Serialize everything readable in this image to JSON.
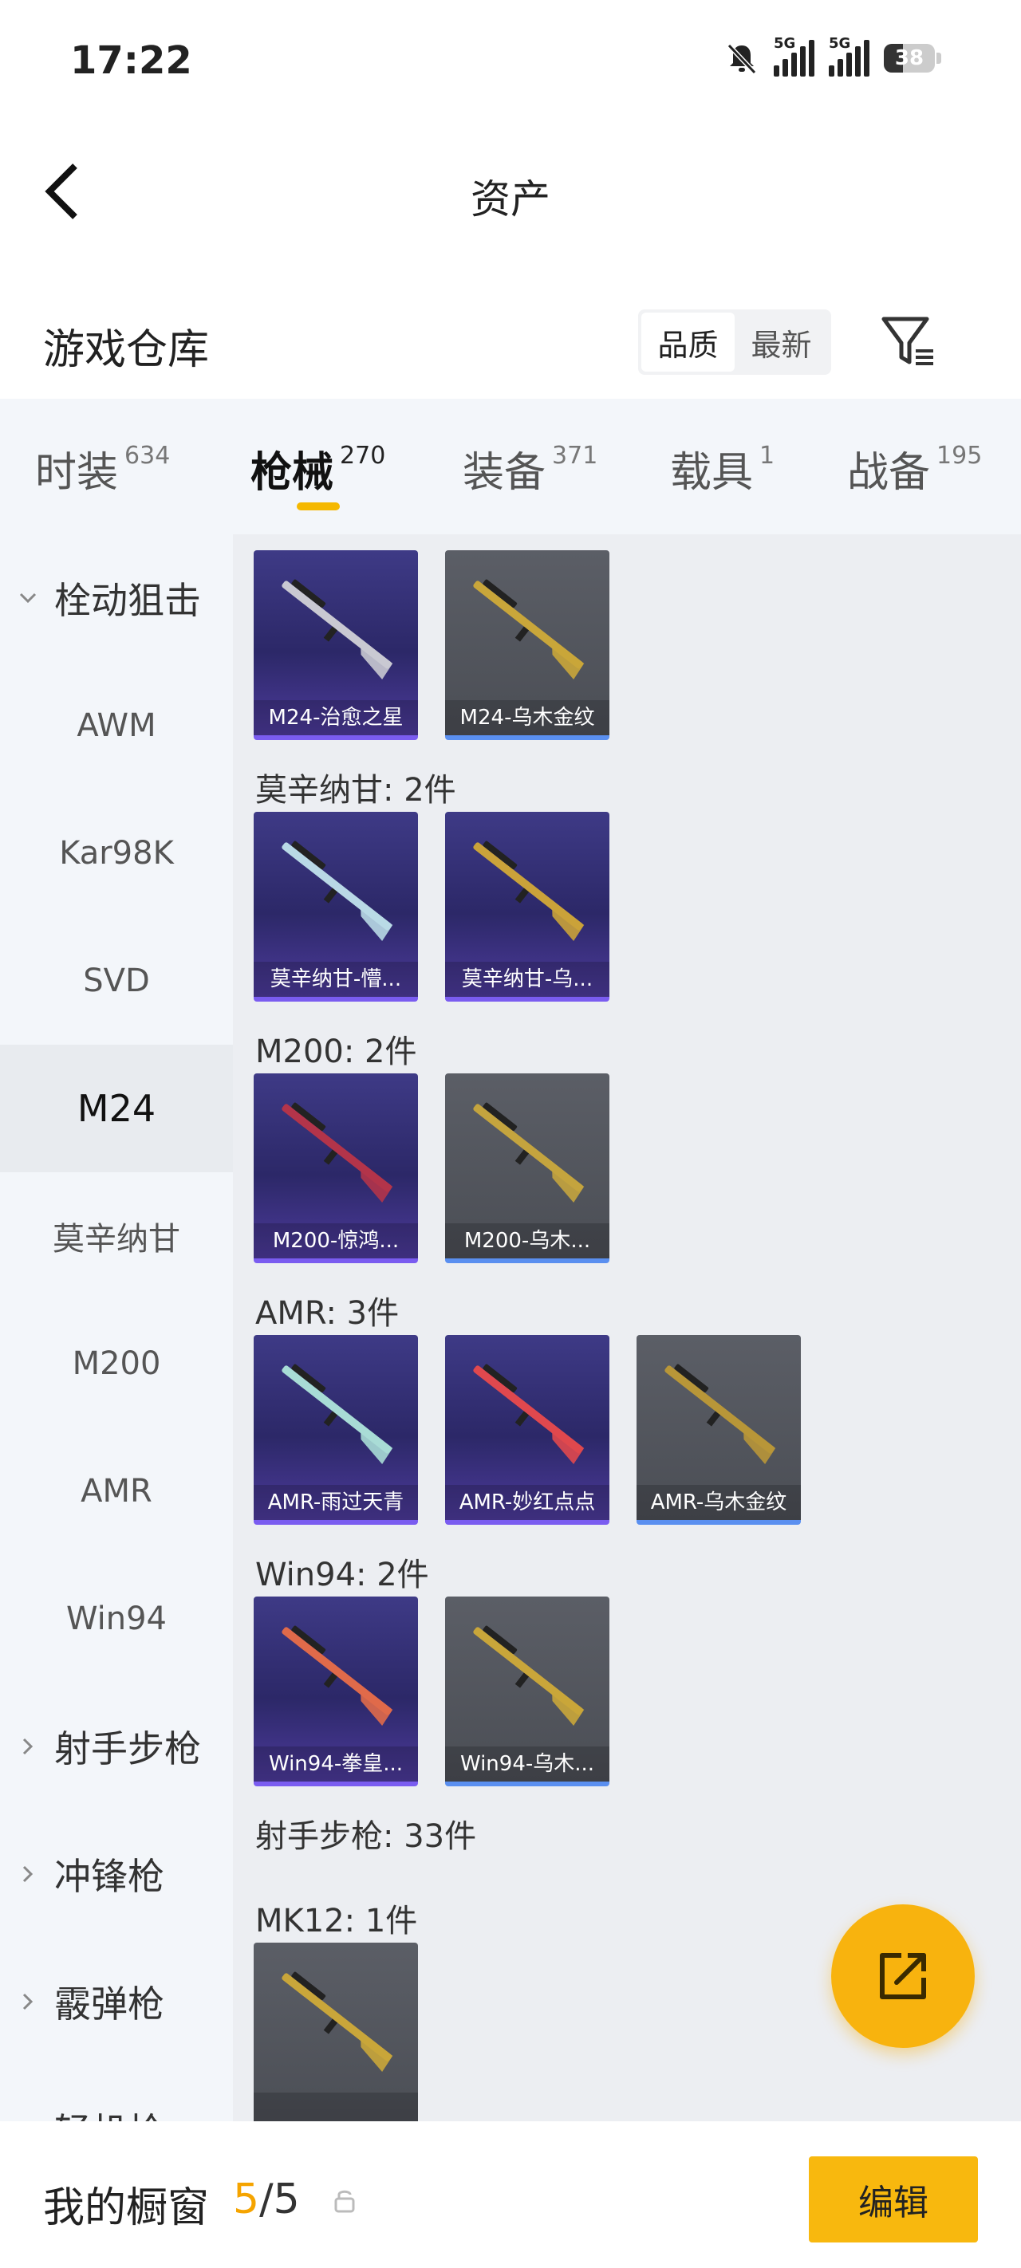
{
  "status_bar": {
    "time": "17:22",
    "signal1": "5G",
    "signal2": "5G",
    "battery": "38",
    "battery_level": 0.38
  },
  "header": {
    "title": "资产"
  },
  "warehouse": {
    "title": "游戏仓库",
    "sort_options": [
      "品质",
      "最新"
    ],
    "active_sort": "品质"
  },
  "tabs": [
    {
      "label": "时装",
      "count": "634"
    },
    {
      "label": "枪械",
      "count": "270",
      "active": true
    },
    {
      "label": "装备",
      "count": "371"
    },
    {
      "label": "载具",
      "count": "1"
    },
    {
      "label": "战备",
      "count": "195"
    }
  ],
  "sidebar": {
    "items": [
      {
        "label": "栓动狙击",
        "type": "category",
        "expanded": true
      },
      {
        "label": "AWM"
      },
      {
        "label": "Kar98K"
      },
      {
        "label": "SVD"
      },
      {
        "label": "M24",
        "active": true
      },
      {
        "label": "莫辛纳甘"
      },
      {
        "label": "M200"
      },
      {
        "label": "AMR"
      },
      {
        "label": "Win94"
      },
      {
        "label": "射手步枪",
        "type": "category"
      },
      {
        "label": "冲锋枪",
        "type": "category"
      },
      {
        "label": "霰弹枪",
        "type": "category"
      },
      {
        "label": "轻机枪",
        "type": "category"
      }
    ]
  },
  "content": {
    "groups": [
      {
        "title": "",
        "items": [
          {
            "name": "M24-治愈之星",
            "rarity": "purple",
            "gun_color": "#c9c9d2"
          },
          {
            "name": "M24-乌木金纹",
            "rarity": "grey",
            "gun_color": "#c9a63a"
          }
        ]
      },
      {
        "title": "莫辛纳甘: 2件",
        "items": [
          {
            "name": "莫辛纳甘-懵...",
            "rarity": "purple",
            "gun_color": "#b9d9e6"
          },
          {
            "name": "莫辛纳甘-乌...",
            "rarity": "purple",
            "gun_color": "#caa23a"
          }
        ]
      },
      {
        "title": "M200: 2件",
        "items": [
          {
            "name": "M200-惊鸿...",
            "rarity": "purple",
            "gun_color": "#b3344a"
          },
          {
            "name": "M200-乌木...",
            "rarity": "grey",
            "gun_color": "#c4a43e"
          }
        ]
      },
      {
        "title": "AMR: 3件",
        "items": [
          {
            "name": "AMR-雨过天青",
            "rarity": "purple",
            "gun_color": "#a8dcd6"
          },
          {
            "name": "AMR-妙红点点",
            "rarity": "purple",
            "gun_color": "#e0484e"
          },
          {
            "name": "AMR-乌木金纹",
            "rarity": "grey",
            "gun_color": "#b89638"
          }
        ]
      },
      {
        "title": "Win94: 2件",
        "items": [
          {
            "name": "Win94-拳皇...",
            "rarity": "purple",
            "gun_color": "#e06a4a"
          },
          {
            "name": "Win94-乌木...",
            "rarity": "grey",
            "gun_color": "#c9a63a"
          }
        ]
      },
      {
        "title": "射手步枪: 33件",
        "items": []
      },
      {
        "title": "MK12: 1件",
        "items": [
          {
            "name": "",
            "rarity": "grey",
            "gun_color": "#c9a63a"
          }
        ]
      }
    ]
  },
  "bottom": {
    "showcase_label": "我的橱窗",
    "showcase_current": "5",
    "showcase_total": "/5",
    "edit_label": "编辑"
  },
  "colors": {
    "accent": "#f8b80e",
    "purple_rarity": "#7a5cf0",
    "grey_rarity": "#5a8ff0"
  }
}
